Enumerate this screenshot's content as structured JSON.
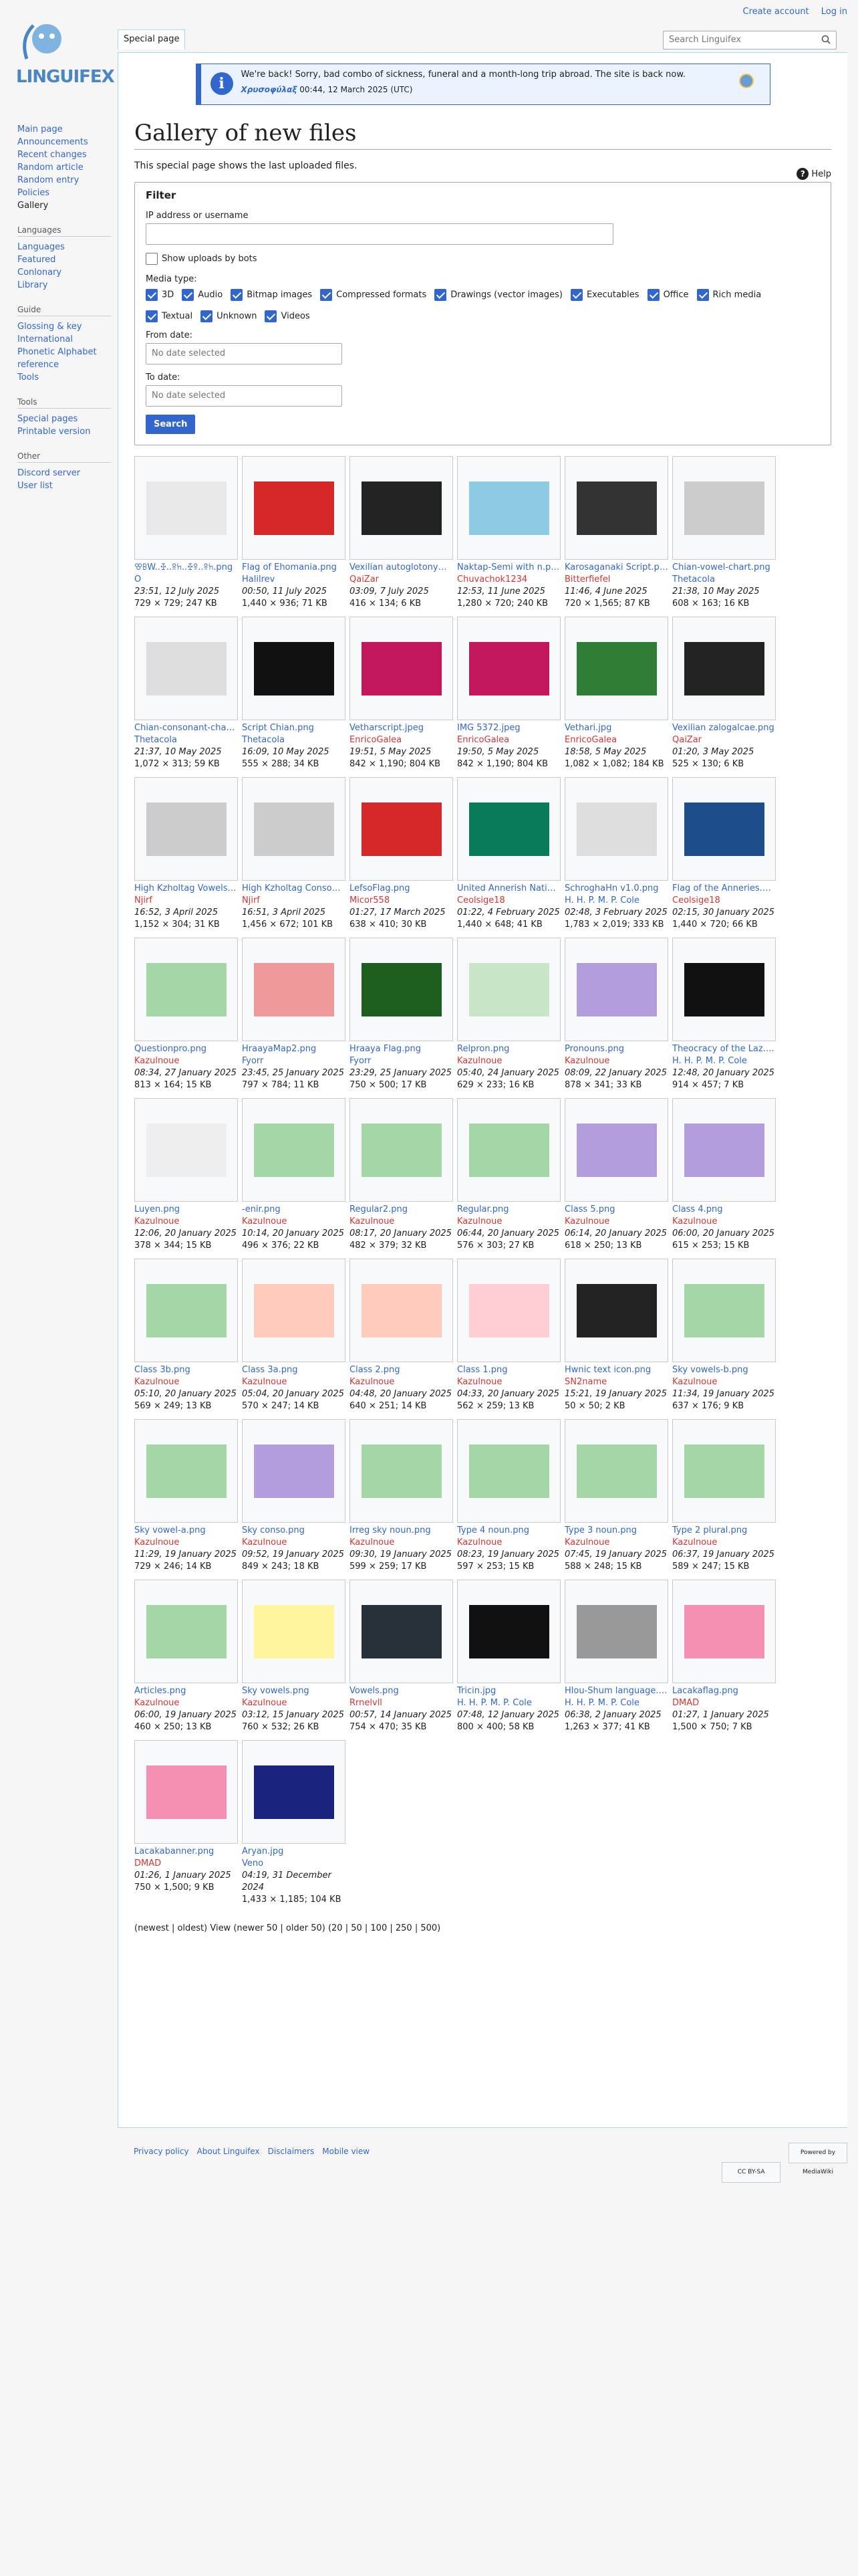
{
  "personal": {
    "create_account": "Create account",
    "login": "Log in"
  },
  "logo": {
    "name": "LINGUIFEX"
  },
  "sidebar": {
    "nav": [
      "Main page",
      "Announcements",
      "Recent changes",
      "Random article",
      "Random entry",
      "Policies",
      "Gallery"
    ],
    "languages": {
      "heading": "Languages",
      "items": [
        "Languages",
        "Featured",
        "Conlonary",
        "Library"
      ]
    },
    "guide": {
      "heading": "Guide",
      "items": [
        "Glossing & key",
        "International Phonetic Alphabet reference",
        "Tools"
      ]
    },
    "tools": {
      "heading": "Tools",
      "items": [
        "Special pages",
        "Printable version"
      ]
    },
    "other": {
      "heading": "Other",
      "items": [
        "Discord server",
        "User list"
      ]
    }
  },
  "tabs": {
    "special": "Special page"
  },
  "search": {
    "placeholder": "Search Linguifex"
  },
  "notice": {
    "message": "We're back! Sorry, bad combo of sickness, funeral and a month-long trip abroad. The site is back now.",
    "author": "Χρυσοφύλαξ",
    "time": "00:44, 12 March 2025 (UTC)"
  },
  "page": {
    "title": "Gallery of new files",
    "help": "Help",
    "intro": "This special page shows the last uploaded files."
  },
  "filter": {
    "legend": "Filter",
    "ip_label": "IP address or username",
    "show_bots": "Show uploads by bots",
    "media_label": "Media type:",
    "media_types": [
      "3D",
      "Audio",
      "Bitmap images",
      "Compressed formats",
      "Drawings (vector images)",
      "Executables",
      "Office",
      "Rich media",
      "Textual",
      "Unknown",
      "Videos"
    ],
    "from_label": "From date:",
    "to_label": "To date:",
    "date_placeholder": "No date selected",
    "search_button": "Search"
  },
  "gallery": [
    {
      "name": "ꕢꕗW..ꔀ..ꕉꖷ..ꔀꕉ..ꕉꖷ.png",
      "user": "O",
      "red": false,
      "time": "23:51, 12 July 2025",
      "meta": "729 × 729; 247 KB",
      "color": "#e8e8e8"
    },
    {
      "name": "Flag of Ehomania.png",
      "user": "Halilrev",
      "red": false,
      "time": "00:50, 11 July 2025",
      "meta": "1,440 × 936; 71 KB",
      "color": "#d62828"
    },
    {
      "name": "Vexilian autoglotonym.png",
      "user": "QaiZar",
      "red": true,
      "time": "03:09, 7 July 2025",
      "meta": "416 × 134; 6 KB",
      "color": "#222222"
    },
    {
      "name": "Naktap-Semi with n.png",
      "user": "Chuvachok1234",
      "red": true,
      "time": "12:53, 11 June 2025",
      "meta": "1,280 × 720; 240 KB",
      "color": "#8ecae6"
    },
    {
      "name": "Karosaganaki Script.png",
      "user": "Bitterfiefel",
      "red": true,
      "time": "11:46, 4 June 2025",
      "meta": "720 × 1,565; 87 KB",
      "color": "#333333"
    },
    {
      "name": "Chian-vowel-chart.png",
      "user": "Thetacola",
      "red": false,
      "time": "21:38, 10 May 2025",
      "meta": "608 × 163; 16 KB",
      "color": "#cccccc"
    },
    {
      "name": "Chian-consonant-chart.png",
      "user": "Thetacola",
      "red": false,
      "time": "21:37, 10 May 2025",
      "meta": "1,072 × 313; 59 KB",
      "color": "#dddddd"
    },
    {
      "name": "Script Chian.png",
      "user": "Thetacola",
      "red": false,
      "time": "16:09, 10 May 2025",
      "meta": "555 × 288; 34 KB",
      "color": "#111111"
    },
    {
      "name": "Vetharscript.jpeg",
      "user": "EnricoGalea",
      "red": true,
      "time": "19:51, 5 May 2025",
      "meta": "842 × 1,190; 804 KB",
      "color": "#c2185b"
    },
    {
      "name": "IMG 5372.jpeg",
      "user": "EnricoGalea",
      "red": true,
      "time": "19:50, 5 May 2025",
      "meta": "842 × 1,190; 804 KB",
      "color": "#c2185b"
    },
    {
      "name": "Vethari.jpg",
      "user": "EnricoGalea",
      "red": true,
      "time": "18:58, 5 May 2025",
      "meta": "1,082 × 1,082; 184 KB",
      "color": "#2e7d32"
    },
    {
      "name": "Vexilian zalogalcae.png",
      "user": "QaiZar",
      "red": true,
      "time": "01:20, 3 May 2025",
      "meta": "525 × 130; 6 KB",
      "color": "#222222"
    },
    {
      "name": "High Kzholtag Vowels.png",
      "user": "Njirf",
      "red": true,
      "time": "16:52, 3 April 2025",
      "meta": "1,152 × 304; 31 KB",
      "color": "#cccccc"
    },
    {
      "name": "High Kzholtag Consonants.png",
      "user": "Njirf",
      "red": true,
      "time": "16:51, 3 April 2025",
      "meta": "1,456 × 672; 101 KB",
      "color": "#cccccc"
    },
    {
      "name": "LefsoFlag.png",
      "user": "Micor558",
      "red": true,
      "time": "01:27, 17 March 2025",
      "meta": "638 × 410; 30 KB",
      "color": "#d62828"
    },
    {
      "name": "United Annerish Nations.png",
      "user": "Ceolsige18",
      "red": true,
      "time": "01:22, 4 February 2025",
      "meta": "1,440 × 648; 41 KB",
      "color": "#0a7c5c"
    },
    {
      "name": "SchroghaHn v1.0.png",
      "user": "H. H. P. M. P. Cole",
      "red": false,
      "time": "02:48, 3 February 2025",
      "meta": "1,783 × 2,019; 333 KB",
      "color": "#dddddd"
    },
    {
      "name": "Flag of the Anneries.png",
      "user": "Ceolsige18",
      "red": true,
      "time": "02:15, 30 January 2025",
      "meta": "1,440 × 720; 66 KB",
      "color": "#1d4e89"
    },
    {
      "name": "Questionpro.png",
      "user": "Kazulnoue",
      "red": true,
      "time": "08:34, 27 January 2025",
      "meta": "813 × 164; 15 KB",
      "color": "#a5d6a7"
    },
    {
      "name": "HraayaMap2.png",
      "user": "Fyorr",
      "red": false,
      "time": "23:45, 25 January 2025",
      "meta": "797 × 784; 11 KB",
      "color": "#ef9a9a"
    },
    {
      "name": "Hraaya Flag.png",
      "user": "Fyorr",
      "red": false,
      "time": "23:29, 25 January 2025",
      "meta": "750 × 500; 17 KB",
      "color": "#1b5e20"
    },
    {
      "name": "Relpron.png",
      "user": "Kazulnoue",
      "red": true,
      "time": "05:40, 24 January 2025",
      "meta": "629 × 233; 16 KB",
      "color": "#c8e6c9"
    },
    {
      "name": "Pronouns.png",
      "user": "Kazulnoue",
      "red": true,
      "time": "08:09, 22 January 2025",
      "meta": "878 × 341; 33 KB",
      "color": "#b39ddb"
    },
    {
      "name": "Theocracy of the Laz.png",
      "user": "H. H. P. M. P. Cole",
      "red": false,
      "time": "12:48, 20 January 2025",
      "meta": "914 × 457; 7 KB",
      "color": "#111111"
    },
    {
      "name": "Luyen.png",
      "user": "Kazulnoue",
      "red": true,
      "time": "12:06, 20 January 2025",
      "meta": "378 × 344; 15 KB",
      "color": "#eeeeee"
    },
    {
      "name": "-enir.png",
      "user": "Kazulnoue",
      "red": true,
      "time": "10:14, 20 January 2025",
      "meta": "496 × 376; 22 KB",
      "color": "#a5d6a7"
    },
    {
      "name": "Regular2.png",
      "user": "Kazulnoue",
      "red": true,
      "time": "08:17, 20 January 2025",
      "meta": "482 × 379; 32 KB",
      "color": "#a5d6a7"
    },
    {
      "name": "Regular.png",
      "user": "Kazulnoue",
      "red": true,
      "time": "06:44, 20 January 2025",
      "meta": "576 × 303; 27 KB",
      "color": "#a5d6a7"
    },
    {
      "name": "Class 5.png",
      "user": "Kazulnoue",
      "red": true,
      "time": "06:14, 20 January 2025",
      "meta": "618 × 250; 13 KB",
      "color": "#b39ddb"
    },
    {
      "name": "Class 4.png",
      "user": "Kazulnoue",
      "red": true,
      "time": "06:00, 20 January 2025",
      "meta": "615 × 253; 15 KB",
      "color": "#b39ddb"
    },
    {
      "name": "Class 3b.png",
      "user": "Kazulnoue",
      "red": true,
      "time": "05:10, 20 January 2025",
      "meta": "569 × 249; 13 KB",
      "color": "#a5d6a7"
    },
    {
      "name": "Class 3a.png",
      "user": "Kazulnoue",
      "red": true,
      "time": "05:04, 20 January 2025",
      "meta": "570 × 247; 14 KB",
      "color": "#ffccbc"
    },
    {
      "name": "Class 2.png",
      "user": "Kazulnoue",
      "red": true,
      "time": "04:48, 20 January 2025",
      "meta": "640 × 251; 14 KB",
      "color": "#ffccbc"
    },
    {
      "name": "Class 1.png",
      "user": "Kazulnoue",
      "red": true,
      "time": "04:33, 20 January 2025",
      "meta": "562 × 259; 13 KB",
      "color": "#ffcdd2"
    },
    {
      "name": "Hwnic text icon.png",
      "user": "SN2name",
      "red": true,
      "time": "15:21, 19 January 2025",
      "meta": "50 × 50; 2 KB",
      "color": "#222222"
    },
    {
      "name": "Sky vowels-b.png",
      "user": "Kazulnoue",
      "red": true,
      "time": "11:34, 19 January 2025",
      "meta": "637 × 176; 9 KB",
      "color": "#a5d6a7"
    },
    {
      "name": "Sky vowel-a.png",
      "user": "Kazulnoue",
      "red": true,
      "time": "11:29, 19 January 2025",
      "meta": "729 × 246; 14 KB",
      "color": "#a5d6a7"
    },
    {
      "name": "Sky conso.png",
      "user": "Kazulnoue",
      "red": true,
      "time": "09:52, 19 January 2025",
      "meta": "849 × 243; 18 KB",
      "color": "#b39ddb"
    },
    {
      "name": "Irreg sky noun.png",
      "user": "Kazulnoue",
      "red": true,
      "time": "09:30, 19 January 2025",
      "meta": "599 × 259; 17 KB",
      "color": "#a5d6a7"
    },
    {
      "name": "Type 4 noun.png",
      "user": "Kazulnoue",
      "red": true,
      "time": "08:23, 19 January 2025",
      "meta": "597 × 253; 15 KB",
      "color": "#a5d6a7"
    },
    {
      "name": "Type 3 noun.png",
      "user": "Kazulnoue",
      "red": true,
      "time": "07:45, 19 January 2025",
      "meta": "588 × 248; 15 KB",
      "color": "#a5d6a7"
    },
    {
      "name": "Type 2 plural.png",
      "user": "Kazulnoue",
      "red": true,
      "time": "06:37, 19 January 2025",
      "meta": "589 × 247; 15 KB",
      "color": "#a5d6a7"
    },
    {
      "name": "Articles.png",
      "user": "Kazulnoue",
      "red": true,
      "time": "06:00, 19 January 2025",
      "meta": "460 × 250; 13 KB",
      "color": "#a5d6a7"
    },
    {
      "name": "Sky vowels.png",
      "user": "Kazulnoue",
      "red": true,
      "time": "03:12, 15 January 2025",
      "meta": "760 × 532; 26 KB",
      "color": "#fff59d"
    },
    {
      "name": "Vowels.png",
      "user": "Rrnelvll",
      "red": true,
      "time": "00:57, 14 January 2025",
      "meta": "754 × 470; 35 KB",
      "color": "#263238"
    },
    {
      "name": "Tricin.jpg",
      "user": "H. H. P. M. P. Cole",
      "red": false,
      "time": "07:48, 12 January 2025",
      "meta": "800 × 400; 58 KB",
      "color": "#111111"
    },
    {
      "name": "Hlou-Shum language.png",
      "user": "H. H. P. M. P. Cole",
      "red": false,
      "time": "06:38, 2 January 2025",
      "meta": "1,263 × 377; 41 KB",
      "color": "#999999"
    },
    {
      "name": "Lacakaflag.png",
      "user": "DMAD",
      "red": true,
      "time": "01:27, 1 January 2025",
      "meta": "1,500 × 750; 7 KB",
      "color": "#f48fb1"
    },
    {
      "name": "Lacakabanner.png",
      "user": "DMAD",
      "red": true,
      "time": "01:26, 1 January 2025",
      "meta": "750 × 1,500; 9 KB",
      "color": "#f48fb1"
    },
    {
      "name": "Aryan.jpg",
      "user": "Veno",
      "red": false,
      "time": "04:19, 31 December 2024",
      "meta": "1,433 × 1,185; 104 KB",
      "color": "#1a237e"
    }
  ],
  "pager": {
    "text": "(newest | oldest) View (newer 50 | older 50) (20 | 50 | 100 | 250 | 500)"
  },
  "footer": {
    "links": [
      "Privacy policy",
      "About Linguifex",
      "Disclaimers",
      "Mobile view"
    ],
    "cc": "CC BY-SA",
    "mw": "Powered by MediaWiki"
  }
}
